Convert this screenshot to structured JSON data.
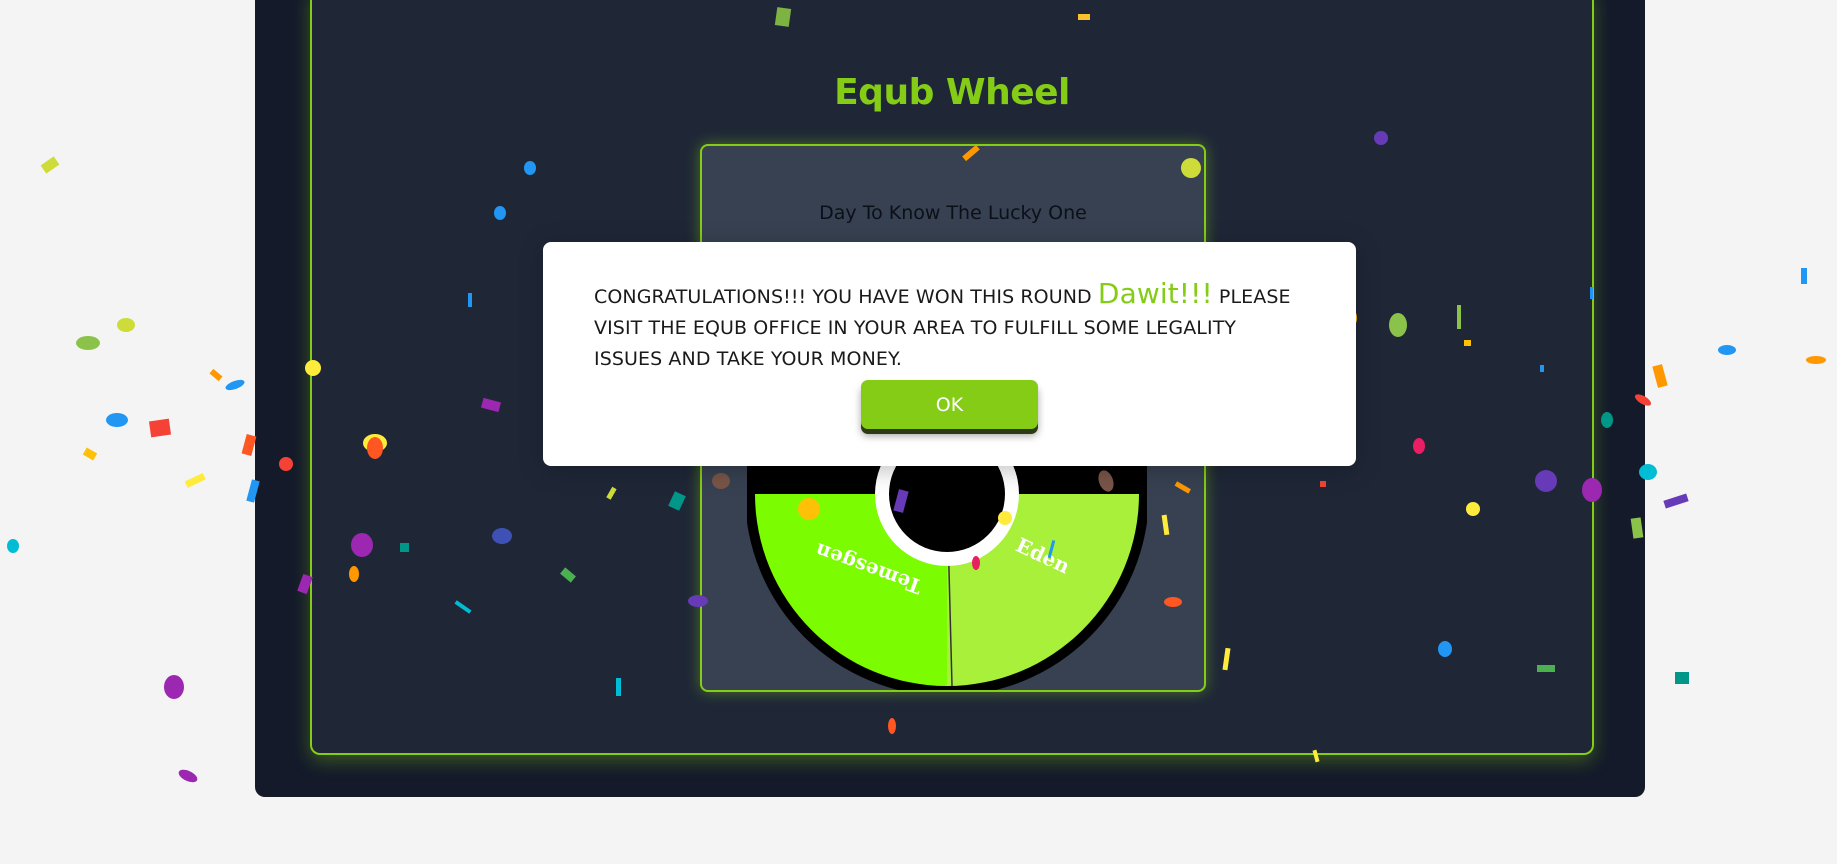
{
  "page": {
    "title": "Equb Wheel",
    "wheel_card_heading": "Day To Know The Lucky One"
  },
  "wheel": {
    "segment_labels": [
      "Temesgen",
      "Eden"
    ],
    "colors": {
      "segment_left": "#7cfc00",
      "segment_right": "#a8f03a",
      "rim": "#000000"
    }
  },
  "modal": {
    "message_prefix": "CONGRATULATIONS!!! YOU HAVE WON THIS ROUND ",
    "winner": "Dawit!!!",
    "message_suffix": " PLEASE VISIT THE EQUB OFFICE IN YOUR AREA TO FULFILL SOME LEGALITY ISSUES AND TAKE YOUR MONEY.",
    "ok_label": "OK"
  },
  "colors": {
    "accent": "#84cc16",
    "frame_bg": "#141a2a",
    "panel_bg": "#1f2737",
    "card_bg": "#374151",
    "page_bg": "#f4f4f4"
  }
}
